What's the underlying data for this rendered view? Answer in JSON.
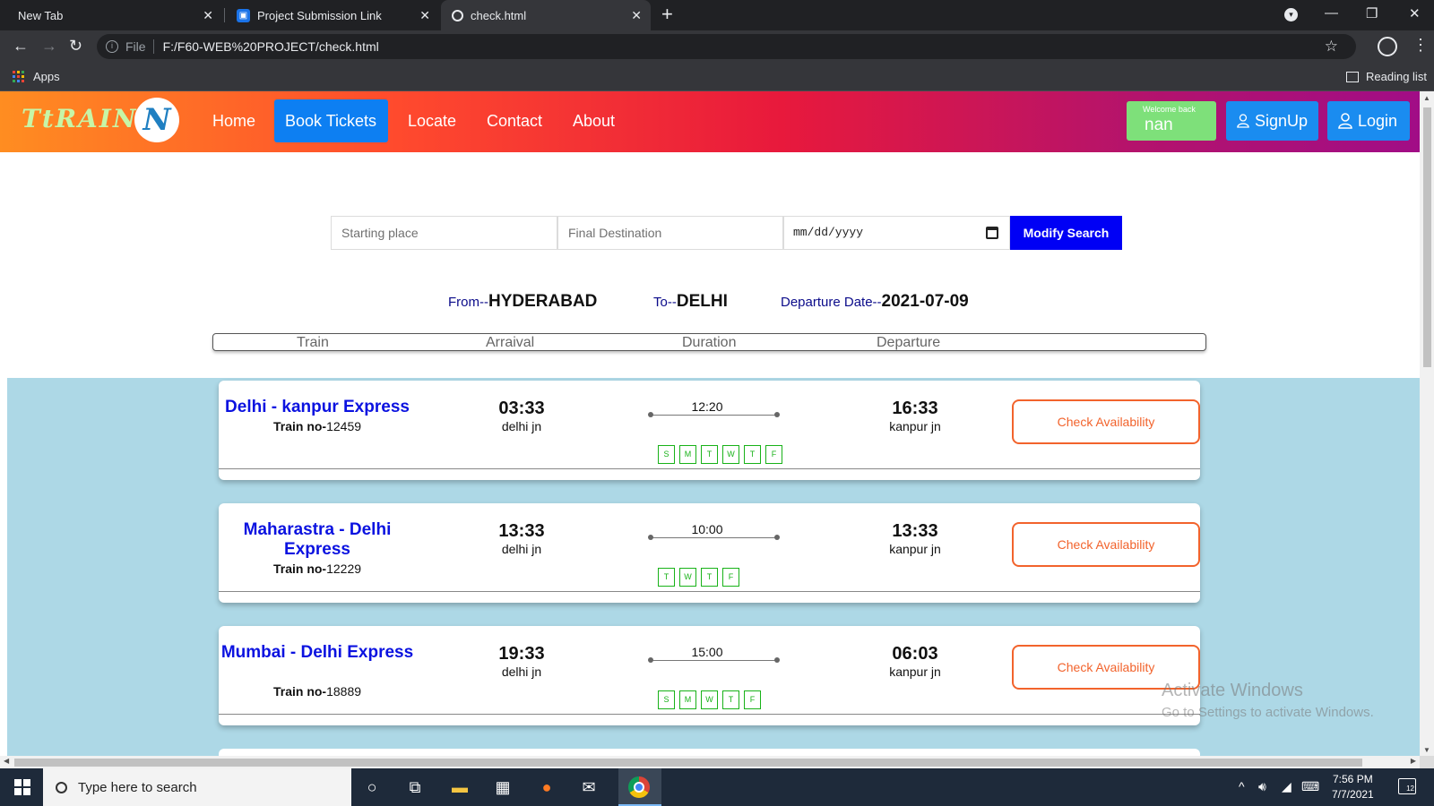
{
  "browser": {
    "tabs": [
      {
        "title": "New Tab"
      },
      {
        "title": "Project Submission Link"
      },
      {
        "title": "check.html"
      }
    ],
    "address": {
      "scheme": "File",
      "url": "F:/F60-WEB%20PROJECT/check.html"
    },
    "bookmarks": {
      "apps_label": "Apps",
      "reading_list_label": "Reading list"
    }
  },
  "site": {
    "brand": "TtRAIN",
    "logo_letter": "N",
    "nav": {
      "home": "Home",
      "book_tickets": "Book Tickets",
      "locate": "Locate",
      "contact": "Contact",
      "about": "About"
    },
    "welcome": {
      "caption": "Welcome back",
      "name": "nan"
    },
    "auth": {
      "signup": "SignUp",
      "login": "Login"
    }
  },
  "search": {
    "start_placeholder": "Starting place",
    "dest_placeholder": "Final Destination",
    "date_placeholder": "mm/dd/yyyy",
    "button": "Modify Search"
  },
  "summary": {
    "from_label": "From--",
    "from_value": "HYDERABAD",
    "to_label": "To--",
    "to_value": "DELHI",
    "date_label": "Departure Date--",
    "date_value": "2021-07-09"
  },
  "results_header": {
    "train": "Train",
    "arrival": "Arraival",
    "duration": "Duration",
    "departure": "Departure"
  },
  "trains": [
    {
      "name": "Delhi - kanpur Express",
      "no_label": "Train no-",
      "no": "12459",
      "arrival_time": "03:33",
      "arrival_station": "delhi jn",
      "duration": "12:20",
      "departure_time": "16:33",
      "departure_station": "kanpur jn",
      "days": [
        "S",
        "M",
        "T",
        "W",
        "T",
        "F"
      ],
      "button": "Check Availability"
    },
    {
      "name": "Maharastra - Delhi Express",
      "no_label": "Train no-",
      "no": "12229",
      "arrival_time": "13:33",
      "arrival_station": "delhi jn",
      "duration": "10:00",
      "departure_time": "13:33",
      "departure_station": "kanpur jn",
      "days": [
        "T",
        "W",
        "T",
        "F"
      ],
      "button": "Check Availability"
    },
    {
      "name": "Mumbai - Delhi Express",
      "no_label": "Train no-",
      "no": "18889",
      "arrival_time": "19:33",
      "arrival_station": "delhi jn",
      "duration": "15:00",
      "departure_time": "06:03",
      "departure_station": "kanpur jn",
      "days": [
        "S",
        "M",
        "W",
        "T",
        "F"
      ],
      "button": "Check Availability"
    }
  ],
  "watermark": {
    "line1": "Activate Windows",
    "line2": "Go to Settings to activate Windows."
  },
  "taskbar": {
    "search_placeholder": "Type here to search",
    "time": "7:56 PM",
    "date": "7/7/2021",
    "notifications": "12"
  }
}
